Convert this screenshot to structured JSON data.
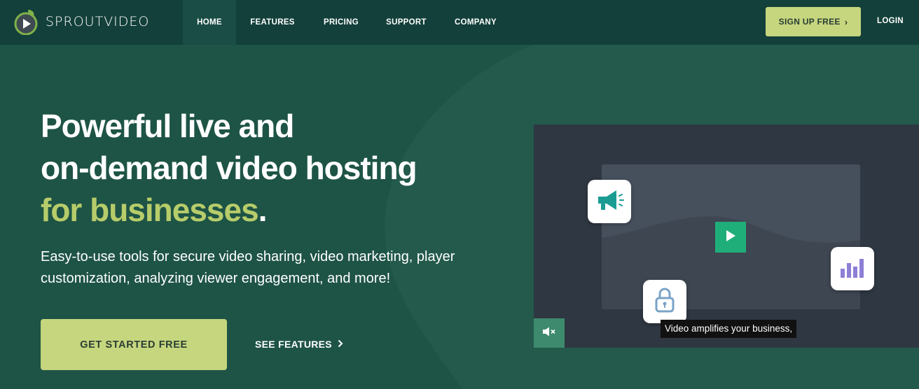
{
  "brand": {
    "name": "SPROUTVIDEO"
  },
  "nav": {
    "items": [
      {
        "label": "HOME",
        "active": true
      },
      {
        "label": "FEATURES",
        "active": false
      },
      {
        "label": "PRICING",
        "active": false
      },
      {
        "label": "SUPPORT",
        "active": false
      },
      {
        "label": "COMPANY",
        "active": false
      }
    ],
    "signup_label": "SIGN UP FREE",
    "login_label": "LOGIN"
  },
  "hero": {
    "title_line1": "Powerful live and",
    "title_line2": "on-demand video hosting",
    "title_accent": "for businesses",
    "title_period": ".",
    "subtitle": "Easy-to-use tools for secure video sharing, video marketing, player customization, analyzing viewer engagement, and more!",
    "cta_primary": "GET STARTED FREE",
    "cta_secondary": "SEE FEATURES"
  },
  "video": {
    "caption": "Video amplifies your business,",
    "icons": [
      "megaphone-icon",
      "bar-chart-icon",
      "lock-icon",
      "play-icon",
      "mute-icon"
    ]
  },
  "colors": {
    "header_bg": "#13403a",
    "hero_bg": "#1e5446",
    "accent": "#b7cc6a",
    "button": "#c6d67e",
    "play": "#1fae79"
  }
}
